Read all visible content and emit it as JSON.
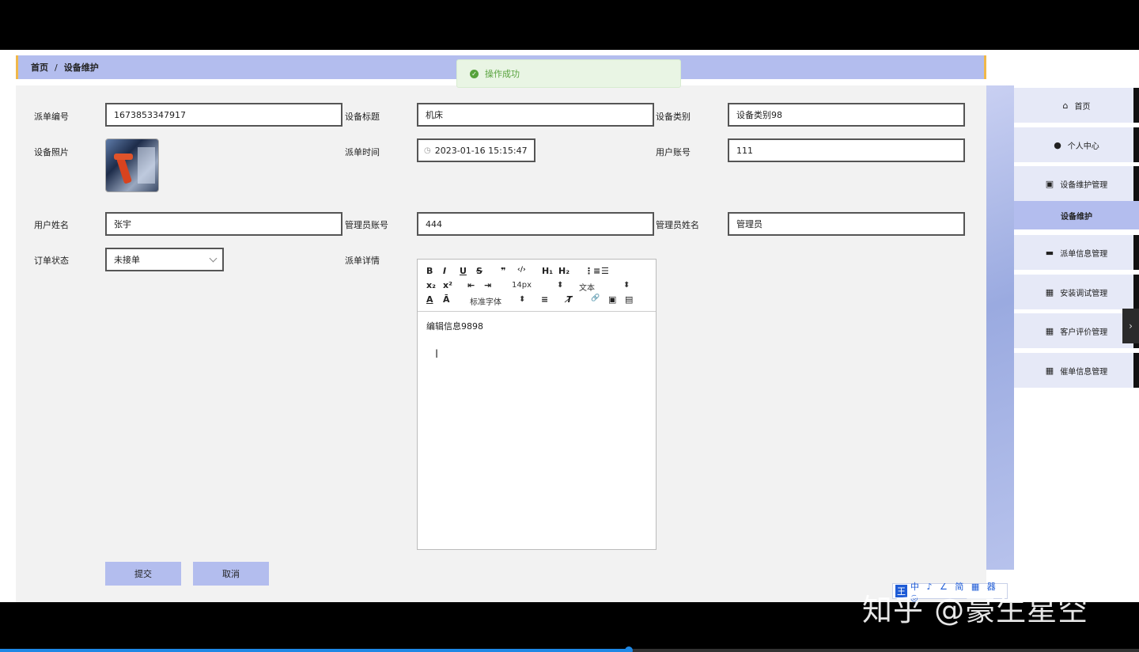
{
  "breadcrumb": {
    "home": "首页",
    "separator": "/",
    "current": "设备维护"
  },
  "toast": {
    "message": "操作成功",
    "icon": "check-circle-icon"
  },
  "form": {
    "dispatch_no_label": "派单编号",
    "dispatch_no_value": "1673853347917",
    "device_title_label": "设备标题",
    "device_title_value": "机床",
    "device_category_label": "设备类别",
    "device_category_value": "设备类别98",
    "device_photo_label": "设备照片",
    "dispatch_time_label": "派单时间",
    "dispatch_time_value": "2023-01-16 15:15:47",
    "user_account_label": "用户账号",
    "user_account_value": "111",
    "user_name_label": "用户姓名",
    "user_name_value": "张宇",
    "admin_account_label": "管理员账号",
    "admin_account_value": "444",
    "admin_name_label": "管理员姓名",
    "admin_name_value": "管理员",
    "order_status_label": "订单状态",
    "order_status_value": "未接单",
    "dispatch_detail_label": "派单详情",
    "submit_label": "提交",
    "cancel_label": "取消"
  },
  "editor": {
    "font_size": "14px",
    "block_format": "文本",
    "font_family": "标准字体",
    "content": "编辑信息9898",
    "tools": {
      "bold": "B",
      "italic": "I",
      "underline": "U",
      "strike": "S",
      "quote": "❞",
      "code": "‹/›",
      "h1": "H₁",
      "h2": "H₂",
      "ordered_list": "⋮≡",
      "bullet_list": "☰",
      "subscript": "x₂",
      "superscript": "x²",
      "outdent": "⇤",
      "indent": "⇥",
      "font_color": "A",
      "bg_color": "Ā",
      "align": "≡",
      "clean": "T̸",
      "link": "🔗",
      "image": "▣",
      "video": "▤"
    }
  },
  "sidebar": {
    "items": [
      {
        "label": "首页",
        "icon": "home-icon",
        "glyph": "⌂"
      },
      {
        "label": "个人中心",
        "icon": "user-icon",
        "glyph": "●"
      },
      {
        "label": "设备维护管理",
        "icon": "clipboard-icon",
        "glyph": "▣"
      },
      {
        "label": "派单信息管理",
        "icon": "briefcase-icon",
        "glyph": "▬"
      },
      {
        "label": "安装调试管理",
        "icon": "grid-icon",
        "glyph": "▦"
      },
      {
        "label": "客户评价管理",
        "icon": "grid-icon",
        "glyph": "▦"
      },
      {
        "label": "催单信息管理",
        "icon": "grid-icon",
        "glyph": "▦"
      }
    ],
    "active_sub": "设备维护",
    "toggle_glyph": "›"
  },
  "ime": {
    "logo": "王",
    "items": "中 ♪ ∠ 简 ▦ 器 ◎"
  },
  "watermark": "知乎 @豪生星空",
  "colors": {
    "accent": "#b3bdee",
    "toast_green": "#57a23c",
    "bar_border": "#f0b84a"
  }
}
